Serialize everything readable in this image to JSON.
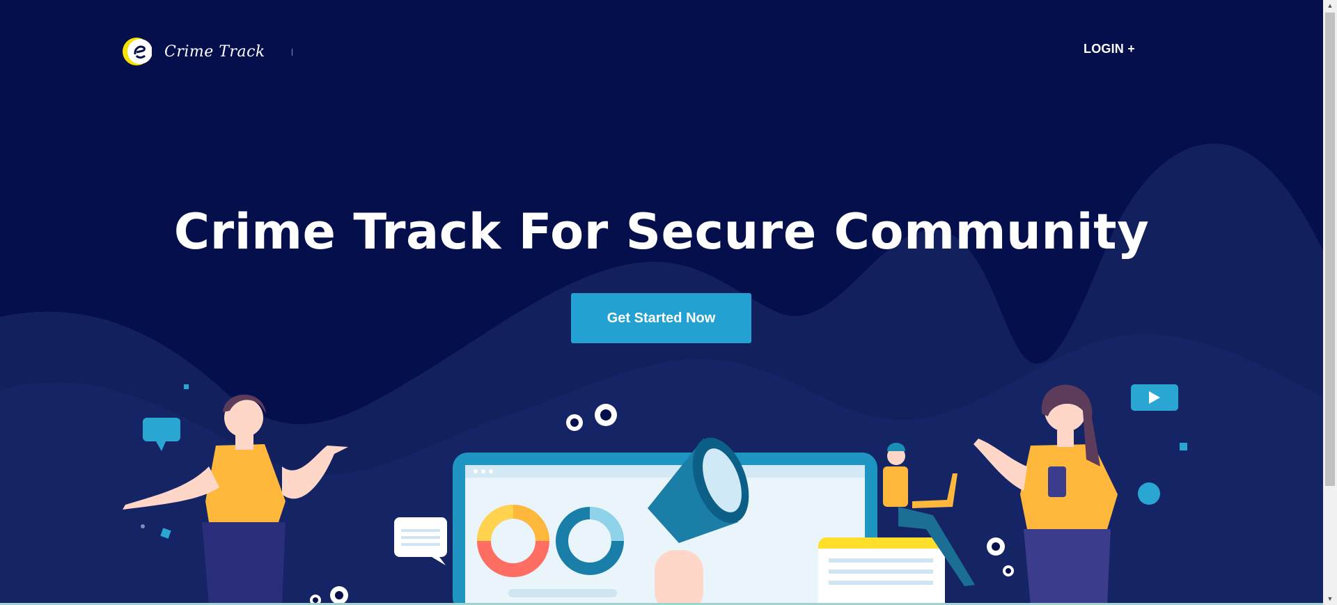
{
  "brand": {
    "name": "Crime Track"
  },
  "nav": {
    "login_label": "LOGIN +"
  },
  "hero": {
    "title": "Crime Track For Secure Community",
    "cta_label": "Get Started Now"
  },
  "colors": {
    "background": "#040f4b",
    "wave": "#12205e",
    "accent": "#23a1d3",
    "yellow": "#ffb83c"
  },
  "icons": [
    "logo-mark-icon",
    "speech-bubble-icon",
    "gear-icon",
    "megaphone-icon",
    "video-play-icon",
    "donut-chart-icon"
  ]
}
